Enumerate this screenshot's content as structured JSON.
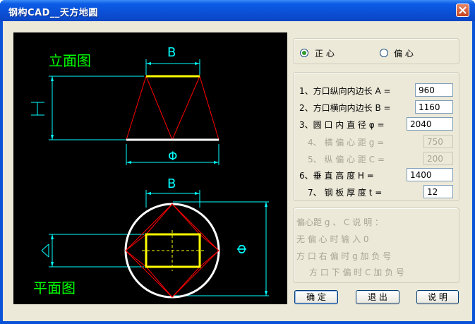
{
  "window": {
    "title": "钢构CAD__天方地圆"
  },
  "drawing": {
    "elevation_label": "立面图",
    "plan_label": "平面图",
    "dim_B": "B",
    "dim_phi": "Φ",
    "dim_H": "H",
    "dim_A": "A"
  },
  "offset_mode": {
    "options": [
      {
        "label": "正 心",
        "selected": true
      },
      {
        "label": "偏 心",
        "selected": false
      }
    ]
  },
  "params": [
    {
      "label": "1、方口纵向内边长 A =",
      "value": "960",
      "enabled": true
    },
    {
      "label": "2、方口横向内边长 B =",
      "value": "1160",
      "enabled": true
    },
    {
      "label": "3、圆 口 内 直 径 φ =",
      "value": "2040",
      "enabled": true
    },
    {
      "label": "4、 横 偏 心 距 g =",
      "value": "750",
      "enabled": false
    },
    {
      "label": "5、 纵 偏 心 距 C =",
      "value": "200",
      "enabled": false
    },
    {
      "label": "6、垂 直 高 度 H =",
      "value": "1400",
      "enabled": true
    },
    {
      "label": "7、 钢 板 厚 度 t =",
      "value": "12",
      "enabled": true
    }
  ],
  "notes": [
    "偏心距  g 、 C 说 明 ：",
    "无 偏 心 时 输 入 0",
    "方 口 右 偏 时  g  加 负 号",
    "方 口 下 偏 时  C  加 负 号"
  ],
  "buttons": {
    "ok": "确  定",
    "exit": "退  出",
    "help": "说  明"
  },
  "colors": {
    "background": "#000000",
    "dimension": "#00ffff",
    "label": "#00ff00",
    "outline": "#ffffff",
    "square": "#ffff00",
    "fold_line": "#ff0000"
  }
}
